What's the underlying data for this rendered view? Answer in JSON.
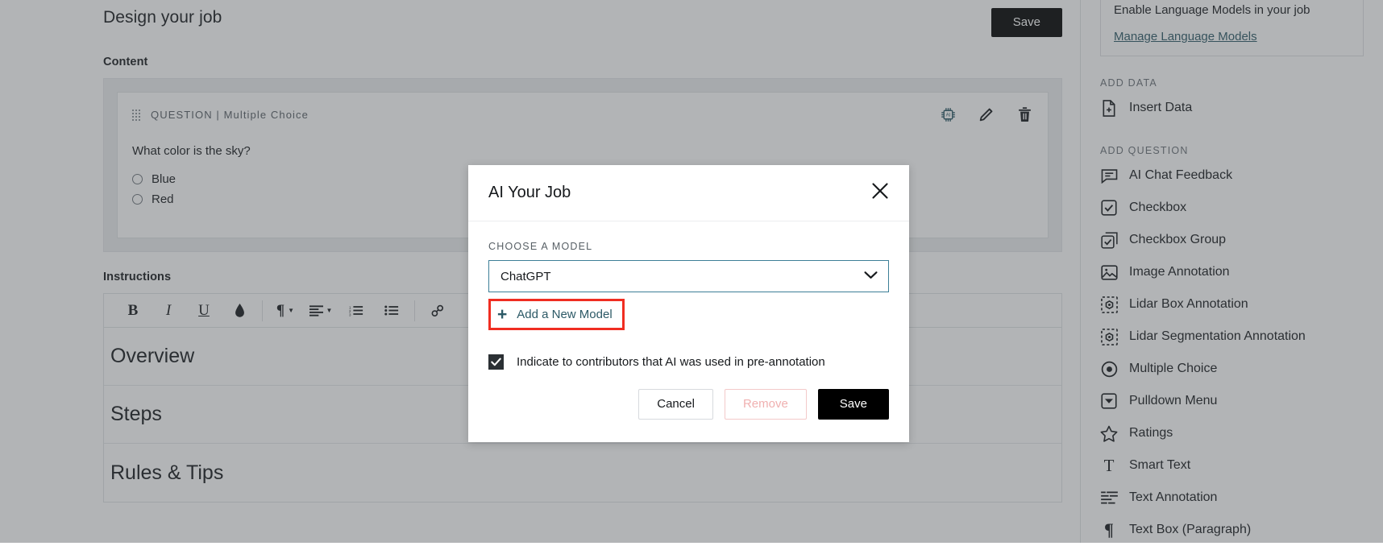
{
  "header": {
    "title": "Design your job",
    "save_label": "Save"
  },
  "content": {
    "section_label": "Content",
    "question_card": {
      "type_label": "QUESTION | Multiple Choice",
      "prompt": "What color is the sky?",
      "options": [
        "Blue",
        "Red"
      ],
      "icons": [
        "ai-chip-icon",
        "pencil-icon",
        "trash-icon"
      ]
    }
  },
  "instructions": {
    "section_label": "Instructions",
    "toolbar": [
      {
        "name": "bold-icon",
        "glyph": "B"
      },
      {
        "name": "italic-icon",
        "glyph": "I"
      },
      {
        "name": "underline-icon",
        "glyph": "U"
      },
      {
        "name": "text-color-icon",
        "glyph": "◆"
      },
      {
        "name": "paragraph-format-icon",
        "glyph": "¶"
      },
      {
        "name": "align-icon",
        "glyph": "≡"
      },
      {
        "name": "ordered-list-icon",
        "glyph": "☰"
      },
      {
        "name": "unordered-list-icon",
        "glyph": "☰"
      },
      {
        "name": "link-icon",
        "glyph": "⚭"
      }
    ],
    "rows": [
      "Overview",
      "Steps",
      "Rules & Tips"
    ]
  },
  "sidebar": {
    "language_models": {
      "text": "Enable Language Models in your job",
      "link": "Manage Language Models"
    },
    "groups": [
      {
        "label": "ADD DATA",
        "items": [
          {
            "label": "Insert Data",
            "icon": "file-plus-icon"
          }
        ]
      },
      {
        "label": "ADD QUESTION",
        "items": [
          {
            "label": "AI Chat Feedback",
            "icon": "chat-bubble-icon"
          },
          {
            "label": "Checkbox",
            "icon": "checkbox-icon"
          },
          {
            "label": "Checkbox Group",
            "icon": "checkbox-group-icon"
          },
          {
            "label": "Image Annotation",
            "icon": "image-icon"
          },
          {
            "label": "Lidar Box Annotation",
            "icon": "lidar-box-icon"
          },
          {
            "label": "Lidar Segmentation Annotation",
            "icon": "lidar-segmentation-icon"
          },
          {
            "label": "Multiple Choice",
            "icon": "radio-icon"
          },
          {
            "label": "Pulldown Menu",
            "icon": "dropdown-icon"
          },
          {
            "label": "Ratings",
            "icon": "star-icon"
          },
          {
            "label": "Smart Text",
            "icon": "text-t-icon"
          },
          {
            "label": "Text Annotation",
            "icon": "text-annotation-icon"
          },
          {
            "label": "Text Box (Paragraph)",
            "icon": "paragraph-icon"
          }
        ]
      }
    ]
  },
  "modal": {
    "title": "AI Your Job",
    "close_icon": "close-icon",
    "field_label": "CHOOSE A MODEL",
    "selected_model": "ChatGPT",
    "chevron_icon": "chevron-down-icon",
    "add_model_label": "Add a New Model",
    "add_model_plus": "+",
    "checkbox_checked": true,
    "checkbox_label": "Indicate to contributors that AI was used in pre-annotation",
    "buttons": {
      "cancel": "Cancel",
      "remove": "Remove",
      "save": "Save"
    },
    "highlight_color": "#f02d21",
    "accent_color": "#2c5966",
    "field_border_color": "#3d7f97"
  }
}
